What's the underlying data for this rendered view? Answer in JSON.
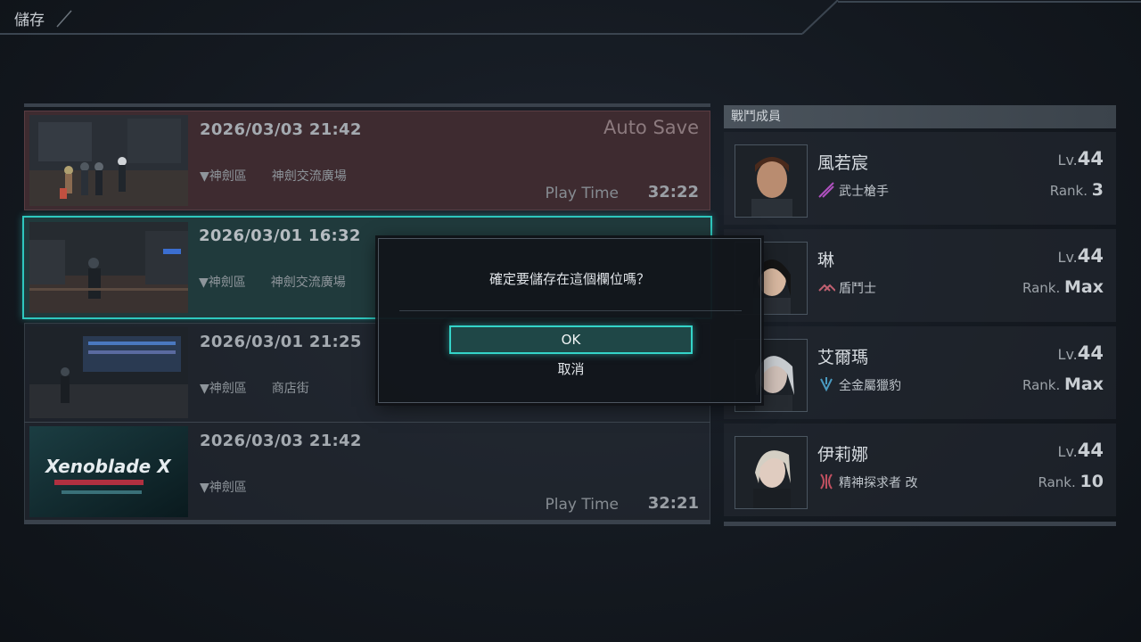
{
  "header": {
    "title": "儲存"
  },
  "slots": [
    {
      "date": "2026/03/03 21:42",
      "location": "▼神劍區　　神劍交流廣場",
      "auto_label": "Auto Save",
      "playtime_label": "Play Time",
      "playtime": "32:22",
      "state": "autosave"
    },
    {
      "date": "2026/03/01 16:32",
      "location": "▼神劍區　　神劍交流廣場",
      "state": "selected"
    },
    {
      "date": "2026/03/01 21:25",
      "location": "▼神劍區　　商店街",
      "state": "normal"
    },
    {
      "date": "2026/03/03 21:42",
      "location": "▼神劍區",
      "playtime_label": "Play Time",
      "playtime": "32:21",
      "state": "normal",
      "thumb_logo": "Xenoblade X"
    }
  ],
  "party": {
    "title": "戰鬥成員",
    "members": [
      {
        "name": "風若宸",
        "class": "武士槍手",
        "level_prefix": "Lv.",
        "level": "44",
        "rank_prefix": "Rank.",
        "rank": "3",
        "icon": "samurai-gunner-icon"
      },
      {
        "name": "琳",
        "class": "盾鬥士",
        "level_prefix": "Lv.",
        "level": "44",
        "rank_prefix": "Rank.",
        "rank": "Max",
        "icon": "shield-trooper-icon"
      },
      {
        "name": "艾爾瑪",
        "class": "全金屬獵豹",
        "level_prefix": "Lv.",
        "level": "44",
        "rank_prefix": "Rank.",
        "rank": "Max",
        "icon": "full-metal-jaguar-icon"
      },
      {
        "name": "伊莉娜",
        "class": "精神探求者 改",
        "level_prefix": "Lv.",
        "level": "44",
        "rank_prefix": "Rank.",
        "rank": "10",
        "icon": "mastermind-icon"
      }
    ]
  },
  "dialog": {
    "message": "確定要儲存在這個欄位嗎？",
    "ok_label": "OK",
    "cancel_label": "取消"
  },
  "colors": {
    "accent": "#34d4c9",
    "autosave_bg": "#3e2b30",
    "background": "#141920"
  }
}
